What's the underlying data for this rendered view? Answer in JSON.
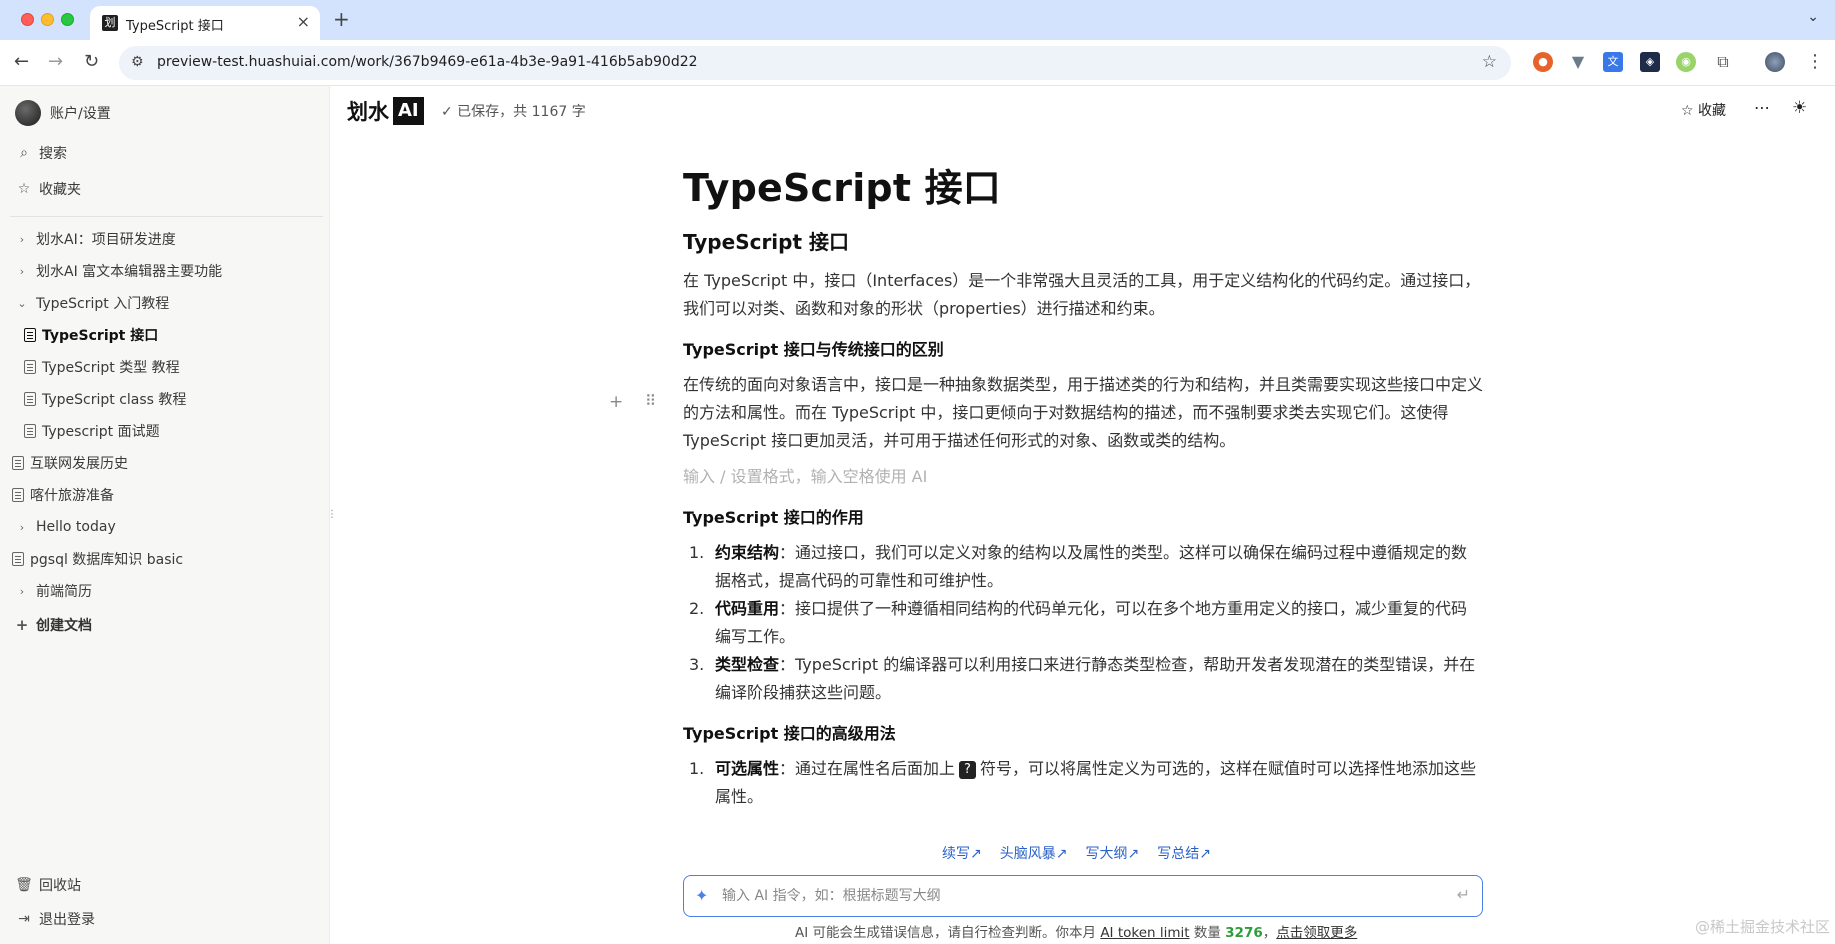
{
  "browser": {
    "tab_favicon_text": "划",
    "tab_title": "TypeScript 接口",
    "tab_close": "×",
    "new_tab": "+",
    "tab_menu": "⌄",
    "url": "preview-test.huashuiai.com/work/367b9469-e61a-4b3e-9a91-416b5ab90d22",
    "extensions": [
      {
        "name": "record-extension-icon",
        "color": "#e8632b"
      },
      {
        "name": "vue-devtools-icon",
        "color": "#6b7b8c"
      },
      {
        "name": "translate-extension-icon",
        "color": "#3b78e7"
      },
      {
        "name": "devtools-extension-icon",
        "color": "#1e2c4a"
      },
      {
        "name": "color-extension-icon",
        "color": "#9bd36b"
      },
      {
        "name": "puzzle-extensions-icon",
        "color": "#555555"
      }
    ]
  },
  "sidebar": {
    "account": "账户/设置",
    "search": "搜索",
    "favorites": "收藏夹",
    "tree": [
      {
        "label": "划水AI：项目研发进度",
        "type": "folder-collapsed"
      },
      {
        "label": "划水AI 富文本编辑器主要功能",
        "type": "folder-collapsed"
      },
      {
        "label": "TypeScript 入门教程",
        "type": "folder-expanded"
      },
      {
        "label": "TypeScript 接口",
        "type": "doc-child-active"
      },
      {
        "label": "TypeScript 类型 教程",
        "type": "doc-child"
      },
      {
        "label": "TypeScript class 教程",
        "type": "doc-child"
      },
      {
        "label": "Typescript 面试题",
        "type": "doc-child"
      },
      {
        "label": "互联网发展历史",
        "type": "doc"
      },
      {
        "label": "喀什旅游准备",
        "type": "doc"
      },
      {
        "label": "Hello today",
        "type": "folder-collapsed"
      },
      {
        "label": "pgsql 数据库知识 basic",
        "type": "doc"
      },
      {
        "label": "前端简历",
        "type": "folder-collapsed"
      }
    ],
    "create_doc": "创建文档",
    "trash": "回收站",
    "logout": "退出登录"
  },
  "header": {
    "logo_text": "划水",
    "logo_ai": "AI",
    "saved_status": "✓ 已保存，共 1167 字",
    "favorite_label": "收藏"
  },
  "document": {
    "title": "TypeScript 接口",
    "h2": "TypeScript 接口",
    "intro": "在 TypeScript 中，接口（Interfaces）是一个非常强大且灵活的工具，用于定义结构化的代码约定。通过接口，我们可以对类、函数和对象的形状（properties）进行描述和约束。",
    "section1_title": "TypeScript 接口与传统接口的区别",
    "section1_body": "在传统的面向对象语言中，接口是一种抽象数据类型，用于描述类的行为和结构，并且类需要实现这些接口中定义的方法和属性。而在 TypeScript 中，接口更倾向于对数据结构的描述，而不强制要求类去实现它们。这使得 TypeScript 接口更加灵活，并可用于描述任何形式的对象、函数或类的结构。",
    "empty_placeholder": "输入 / 设置格式，输入空格使用 AI",
    "section2_title": "TypeScript 接口的作用",
    "section2_items": [
      {
        "num": "1.",
        "bold": "约束结构",
        "text": "：通过接口，我们可以定义对象的结构以及属性的类型。这样可以确保在编码过程中遵循规定的数据格式，提高代码的可靠性和可维护性。"
      },
      {
        "num": "2.",
        "bold": "代码重用",
        "text": "：接口提供了一种遵循相同结构的代码单元化，可以在多个地方重用定义的接口，减少重复的代码编写工作。"
      },
      {
        "num": "3.",
        "bold": "类型检查",
        "text": "：TypeScript 的编译器可以利用接口来进行静态类型检查，帮助开发者发现潜在的类型错误，并在编译阶段捕获这些问题。"
      }
    ],
    "section3_title": "TypeScript 接口的高级用法",
    "section3_item": {
      "num": "1.",
      "bold": "可选属性",
      "text_before": "：通过在属性名后面加上",
      "code": "?",
      "text_after": "符号，可以将属性定义为可选的，这样在赋值时可以选择性地添加这些属性。"
    }
  },
  "ai": {
    "shortcuts": [
      "续写↗",
      "头脑风暴↗",
      "写大纲↗",
      "写总结↗"
    ],
    "input_placeholder": "输入 AI 指令，如：根据标题写大纲",
    "footer_prefix": "AI 可能会生成错误信息，请自行检查判断。你本月",
    "footer_link": "AI token limit",
    "footer_count_label": "数量",
    "footer_count": "3276",
    "footer_sep": "，",
    "footer_more": "点击领取更多"
  },
  "watermark": "@稀土掘金技术社区"
}
